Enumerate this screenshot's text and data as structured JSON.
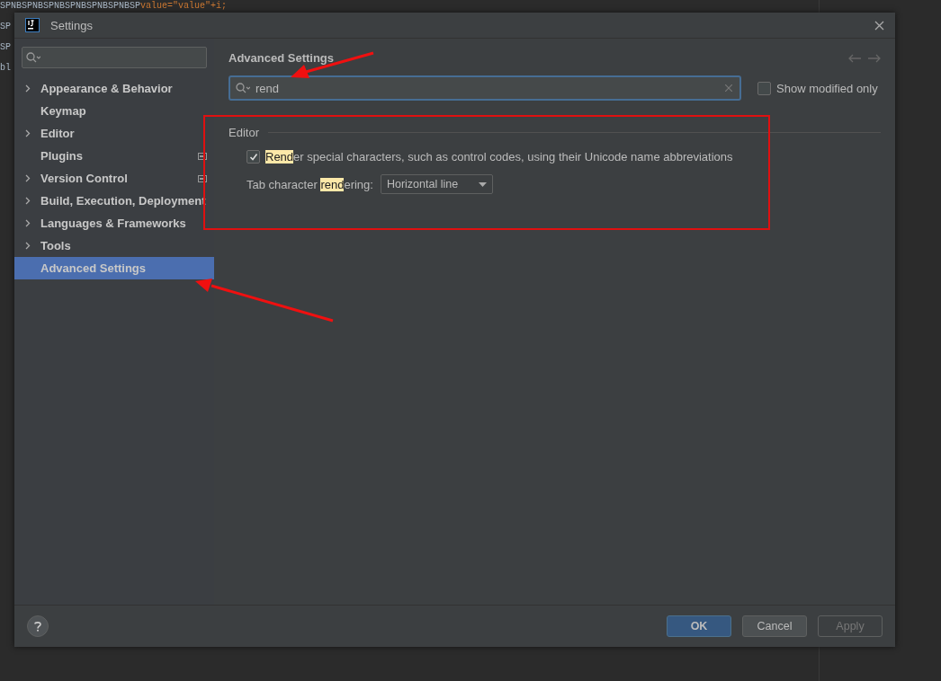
{
  "editor_background": {
    "lines": [
      "SPNBSPNBSPNBSPNBSPNBSPNBSP",
      "SP",
      "SP",
      "bl"
    ],
    "first_line_code": "value=\"value\"+i;"
  },
  "window": {
    "title": "Settings"
  },
  "sidebar": {
    "items": [
      {
        "label": "Appearance & Behavior",
        "expandable": true,
        "badge": false,
        "selected": false
      },
      {
        "label": "Keymap",
        "expandable": false,
        "badge": false,
        "selected": false
      },
      {
        "label": "Editor",
        "expandable": true,
        "badge": false,
        "selected": false
      },
      {
        "label": "Plugins",
        "expandable": false,
        "badge": true,
        "selected": false
      },
      {
        "label": "Version Control",
        "expandable": true,
        "badge": true,
        "selected": false
      },
      {
        "label": "Build, Execution, Deployment",
        "expandable": true,
        "badge": false,
        "selected": false
      },
      {
        "label": "Languages & Frameworks",
        "expandable": true,
        "badge": false,
        "selected": false
      },
      {
        "label": "Tools",
        "expandable": true,
        "badge": false,
        "selected": false
      },
      {
        "label": "Advanced Settings",
        "expandable": false,
        "badge": false,
        "selected": true
      }
    ]
  },
  "content": {
    "heading": "Advanced Settings",
    "search": {
      "value": "rend"
    },
    "show_modified_only": {
      "label": "Show modified only",
      "checked": false
    },
    "section": {
      "title": "Editor",
      "settings": [
        {
          "kind": "checkbox",
          "checked": true,
          "text_parts": [
            {
              "text": "Rend",
              "highlighted": true
            },
            {
              "text": "er special characters, such as control codes, using their Unicode name abbreviations",
              "highlighted": false
            }
          ]
        },
        {
          "kind": "dropdown",
          "value": "Horizontal line",
          "text_parts": [
            {
              "text": "Tab character ",
              "highlighted": false
            },
            {
              "text": "rend",
              "highlighted": true
            },
            {
              "text": "ering:",
              "highlighted": false
            }
          ]
        }
      ]
    }
  },
  "buttons": [
    {
      "label": "OK",
      "kind": "primary",
      "disabled": false
    },
    {
      "label": "Cancel",
      "kind": "normal",
      "disabled": false
    },
    {
      "label": "Apply",
      "kind": "normal",
      "disabled": true
    }
  ]
}
